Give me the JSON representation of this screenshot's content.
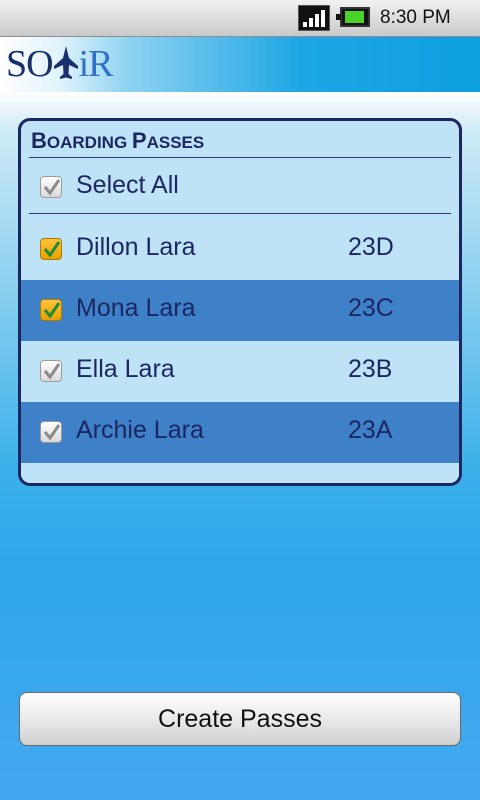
{
  "status_bar": {
    "time": "8:30 PM",
    "signal_icon": "signal-strength-icon",
    "battery_icon": "battery-icon"
  },
  "header": {
    "logo_text_left": "SO",
    "logo_text_right": "iR",
    "logo_icon": "airplane-icon"
  },
  "boarding_passes": {
    "title": "Boarding Passes",
    "select_all_label": "Select All",
    "select_all_checked": false,
    "passengers": [
      {
        "name": "Dillon Lara",
        "seat": "23D",
        "checked": true
      },
      {
        "name": "Mona Lara",
        "seat": "23C",
        "checked": true
      },
      {
        "name": "Ella Lara",
        "seat": "23B",
        "checked": false
      },
      {
        "name": "Archie Lara",
        "seat": "23A",
        "checked": false
      }
    ]
  },
  "actions": {
    "create_label": "Create Passes"
  },
  "colors": {
    "panel_bg": "#bfe3f6",
    "row_highlight": "#3f81c8",
    "text_navy": "#1c2762",
    "checkbox_checked": "#f5b000"
  }
}
